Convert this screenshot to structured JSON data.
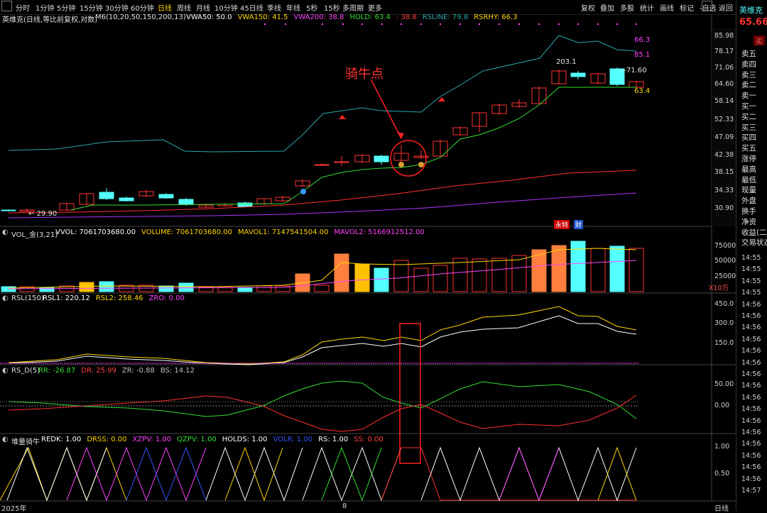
{
  "toolbar": {
    "items": [
      "分时",
      "1分钟",
      "5分钟",
      "15分钟",
      "30分钟",
      "60分钟",
      "日线",
      "周线",
      "月线",
      "10分钟",
      "45日线",
      "季线",
      "年线",
      "5秒",
      "15秒",
      "多周期",
      "更多"
    ],
    "active_index": 6,
    "right_items": [
      "复权",
      "叠加",
      "多股",
      "统计",
      "画线",
      "标记",
      "-自选",
      "返回"
    ]
  },
  "main_chart": {
    "title": "英维克(日线,等比前复权,对数)",
    "indicator_name": "M6(10,20,50,150,200,13)",
    "legend": [
      {
        "text": "VWA50: 50.0",
        "color": "#ffffff"
      },
      {
        "text": "VWA150: 41.5",
        "color": "#ffd700"
      },
      {
        "text": "VWA200: 38.8",
        "color": "#ff44ff"
      },
      {
        "text": "HOLD: 63.4",
        "color": "#33dd33"
      },
      {
        "text": ": 38.8",
        "color": "#ff4040"
      },
      {
        "text": "RSLINE: 79.8",
        "color": "#2aa8a8"
      },
      {
        "text": "RSRHY: 66.3",
        "color": "#ffd700"
      }
    ],
    "y_ticks": [
      "85.98",
      "78.17",
      "71.06",
      "64.60",
      "58.14",
      "52.33",
      "47.09",
      "42.38",
      "38.15",
      "34.33",
      "30.90"
    ],
    "annotation": "骑牛点",
    "labels": {
      "low": "29.90",
      "high": "203.1",
      "last": "71.60",
      "rs_top": "66.3",
      "rs_second": "85.1",
      "hold": "63.4"
    },
    "badges": {
      "b1": "永特",
      "b2": "财"
    }
  },
  "vol_panel": {
    "title": "VOL_金(3,21)",
    "legend": [
      {
        "text": "VVOL: 7061703680.00",
        "color": "#ffffff"
      },
      {
        "text": "VOLUME: 7061703680.00",
        "color": "#ffd700"
      },
      {
        "text": "MAVOL1: 7147541504.00",
        "color": "#ffd700"
      },
      {
        "text": "MAVOL2: 5166912512.00",
        "color": "#ff44ff"
      }
    ],
    "y_ticks": [
      "75000",
      "50000",
      "25000"
    ],
    "unit": "X10万"
  },
  "rsl_panel": {
    "title": "RSL(150)",
    "legend": [
      {
        "text": "RSL1: 220.12",
        "color": "#ffffff"
      },
      {
        "text": "RSL2: 258.46",
        "color": "#ffd700"
      },
      {
        "text": "ZRO: 0.00",
        "color": "#ff44ff"
      }
    ],
    "y_ticks": [
      "450.0",
      "300.0",
      "150.0"
    ]
  },
  "rsd_panel": {
    "title": "RS_D(5)",
    "legend": [
      {
        "text": "RR: -26.87",
        "color": "#33dd33"
      },
      {
        "text": "DR: 25.99",
        "color": "#ff4040"
      },
      {
        "text": "ZR: -0.88",
        "color": "#c0c0c0"
      },
      {
        "text": "BS: 14.12",
        "color": "#c0c0c0"
      }
    ],
    "y_ticks": [
      "50.00",
      "0.00"
    ]
  },
  "dlqn_panel": {
    "title": "堆量骑牛",
    "legend": [
      {
        "text": "REDK: 1.00",
        "color": "#ffffff"
      },
      {
        "text": "DRSS: 0.00",
        "color": "#ffd700"
      },
      {
        "text": "XZPV: 1.00",
        "color": "#ff44ff"
      },
      {
        "text": "QZPV: 1.00",
        "color": "#33dd33"
      },
      {
        "text": "HOLDS: 1.00",
        "color": "#ffffff"
      },
      {
        "text": "VOLR: 1.00",
        "color": "#3355ff"
      },
      {
        "text": "RS: 1.00",
        "color": "#ffffff"
      },
      {
        "text": "SS: 0.00",
        "color": "#ff4040"
      }
    ],
    "y_ticks": [
      "1.00",
      "0.50"
    ]
  },
  "x_axis": {
    "start": "2025年",
    "mid": "8",
    "period": "日线"
  },
  "right_panel": {
    "stock_name": "英维克",
    "price": "65.66",
    "buy_button": "买",
    "labels": [
      "卖五",
      "卖四",
      "卖三",
      "卖二",
      "卖一",
      "买一",
      "买二",
      "买三",
      "买四",
      "买五",
      "涨停",
      "最高",
      "最低",
      "现量",
      "外盘",
      "换手",
      "净资",
      "收益(二)",
      "交易状态"
    ],
    "times": [
      "14:55",
      "14:55",
      "14:55",
      "14:55",
      "14:56",
      "14:56",
      "14:56",
      "14:56",
      "14:56",
      "14:56",
      "14:56",
      "14:56",
      "14:56",
      "14:56",
      "14:56",
      "14:56",
      "14:56",
      "14:56",
      "14:56",
      "14:56",
      "14:57"
    ]
  },
  "colors": {
    "up": "#ff3333",
    "down": "#54ffff",
    "orange": "#ff7f3f",
    "yellow": "#ffc000",
    "accent": "#ffd200"
  }
}
